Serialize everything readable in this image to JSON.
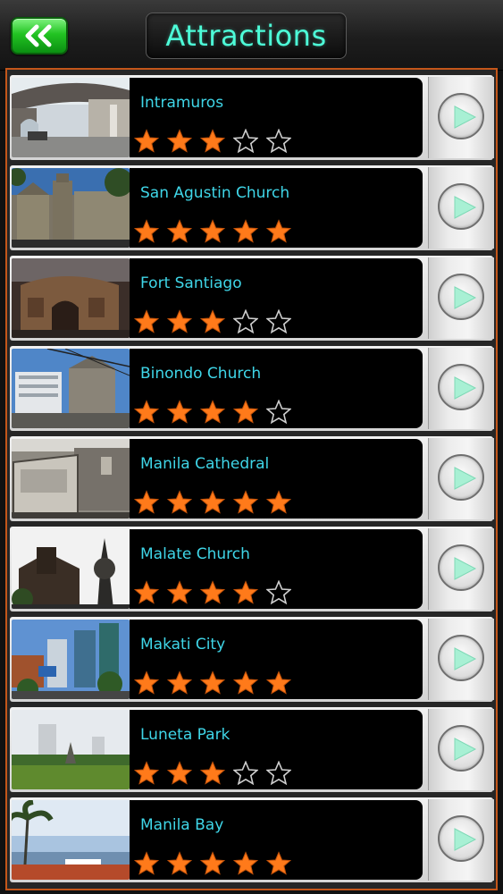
{
  "header": {
    "title": "Attractions",
    "back_icon": "double-chevron-left-icon"
  },
  "colors": {
    "accent_title": "#4dfcd8",
    "item_name": "#3fd6e8",
    "star_filled": "#ff7a1a",
    "frame_border": "#c4561a",
    "back_button": "#22c322"
  },
  "attractions": [
    {
      "name": "Intramuros",
      "rating": 3,
      "max_rating": 5
    },
    {
      "name": "San Agustin Church",
      "rating": 5,
      "max_rating": 5
    },
    {
      "name": "Fort Santiago",
      "rating": 3,
      "max_rating": 5
    },
    {
      "name": "Binondo Church",
      "rating": 4,
      "max_rating": 5
    },
    {
      "name": "Manila Cathedral",
      "rating": 5,
      "max_rating": 5
    },
    {
      "name": "Malate Church",
      "rating": 4,
      "max_rating": 5
    },
    {
      "name": "Makati City",
      "rating": 5,
      "max_rating": 5
    },
    {
      "name": "Luneta Park",
      "rating": 3,
      "max_rating": 5
    },
    {
      "name": "Manila Bay",
      "rating": 5,
      "max_rating": 5
    }
  ]
}
